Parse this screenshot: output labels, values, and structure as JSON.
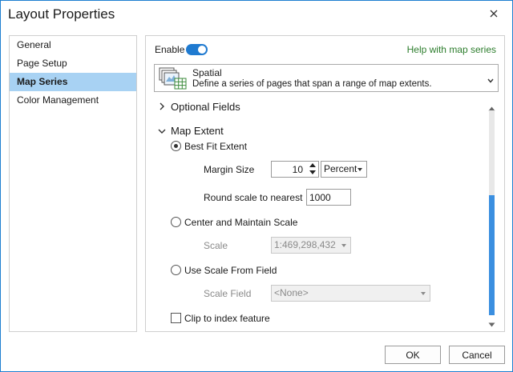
{
  "window": {
    "title": "Layout Properties"
  },
  "nav": {
    "items": [
      {
        "label": "General",
        "active": false
      },
      {
        "label": "Page Setup",
        "active": false
      },
      {
        "label": "Map Series",
        "active": true
      },
      {
        "label": "Color Management",
        "active": false
      }
    ]
  },
  "header": {
    "enable_label": "Enable",
    "enabled": true,
    "help_link": "Help with map series"
  },
  "series_type": {
    "title": "Spatial",
    "description": "Define a series of pages that span a range of map extents."
  },
  "sections": {
    "optional_fields": "Optional Fields",
    "map_extent": "Map Extent"
  },
  "extent": {
    "best_fit_label": "Best Fit Extent",
    "margin_size_label": "Margin Size",
    "margin_size_value": "10",
    "margin_unit": "Percent",
    "round_scale_label": "Round scale to nearest",
    "round_scale_value": "1000",
    "center_label": "Center and Maintain Scale",
    "scale_label": "Scale",
    "scale_value": "1:469,298,432",
    "use_field_label": "Use Scale From Field",
    "scale_field_label": "Scale Field",
    "scale_field_value": "<None>"
  },
  "clip": {
    "label": "Clip to index feature"
  },
  "buttons": {
    "ok": "OK",
    "cancel": "Cancel"
  },
  "colors": {
    "accent": "#1f7ad0",
    "selection": "#a8d2f3",
    "help_link": "#2d7d2d"
  }
}
